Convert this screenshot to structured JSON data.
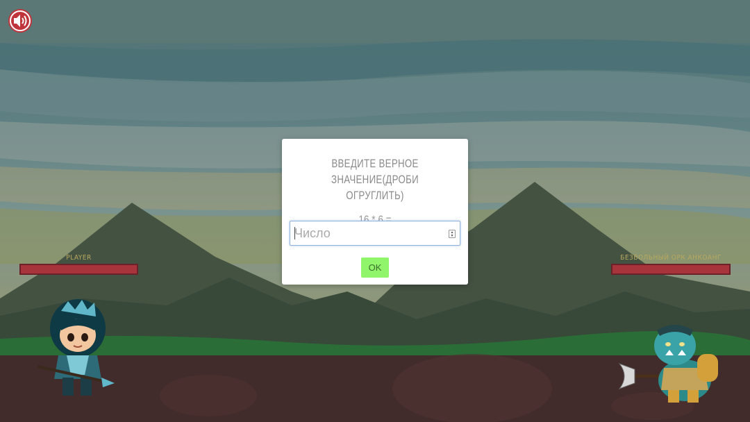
{
  "sound": {
    "icon": "speaker-icon",
    "color": "#c0353b"
  },
  "player": {
    "label": "PLAYER",
    "hp_fraction": 1.0,
    "bar_color": "#a8343b"
  },
  "enemy": {
    "label": "БЕЗВОЛЬНЫЙ ОРК АНКОАНГ",
    "hp_fraction": 1.0,
    "bar_color": "#a8343b"
  },
  "modal": {
    "title": "ВВЕДИТЕ ВЕРНОЕ ЗНАЧЕНИЕ(ДРОБИ ОГРУГЛИТЬ)",
    "question": "16 * 6 =",
    "input_placeholder": "Число",
    "input_value": "",
    "ok_label": "OK",
    "ok_color": "#90f56a"
  }
}
